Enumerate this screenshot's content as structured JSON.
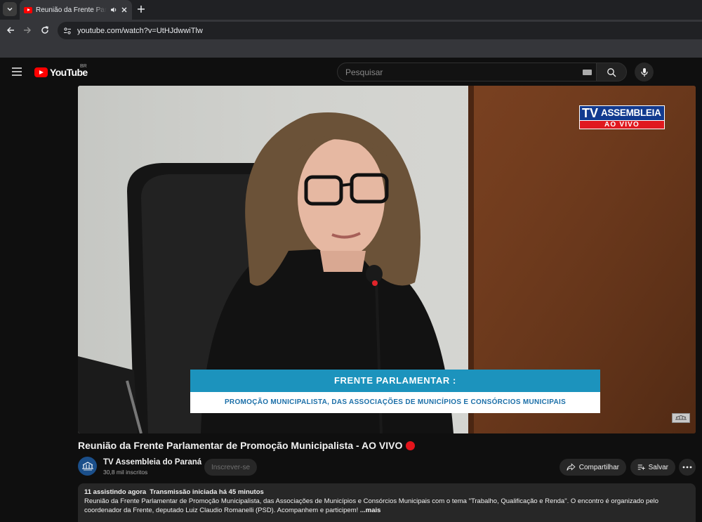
{
  "browser": {
    "tab_title": "Reunião da Frente Parlamentar de Promoção Municipalista",
    "url": "youtube.com/watch?v=UtHJdwwiTlw"
  },
  "masthead": {
    "logo_text": "YouTube",
    "country_code": "BR",
    "search_placeholder": "Pesquisar"
  },
  "player": {
    "station_logo": {
      "tv": "TV",
      "name": "ASSEMBLEIA",
      "live": "AO VIVO"
    },
    "lower_third": {
      "title": "FRENTE PARLAMENTAR :",
      "subtitle": "PROMOÇÃO MUNICIPALISTA, DAS ASSOCIAÇÕES DE MUNICÍPIOS E CONSÓRCIOS MUNICIPAIS"
    }
  },
  "video": {
    "title": "Reunião da Frente Parlamentar de Promoção Municipalista - AO VIVO",
    "channel_name": "TV Assembleia do Paraná",
    "subscribers": "30,8 mil inscritos",
    "subscribe_label": "Inscrever-se",
    "share_label": "Compartilhar",
    "save_label": "Salvar"
  },
  "description": {
    "watching": "11 assistindo agora",
    "started": "Transmissão iniciada há 45 minutos",
    "text": "Reunião da Frente Parlamentar de Promoção Municipalista, das Associações de Municípios e Consórcios Municipais com o tema \"Trabalho, Qualificação e Renda\". O encontro é organizado pelo coordenador da Frente, deputado Luiz Claudio Romanelli (PSD). Acompanhem e participem!",
    "more_label": "...mais"
  },
  "colors": {
    "brand_red": "#ff0000",
    "live_red": "#e4141b",
    "lower_third_blue": "#1c93bd",
    "tv_logo_blue": "#123a8f"
  }
}
